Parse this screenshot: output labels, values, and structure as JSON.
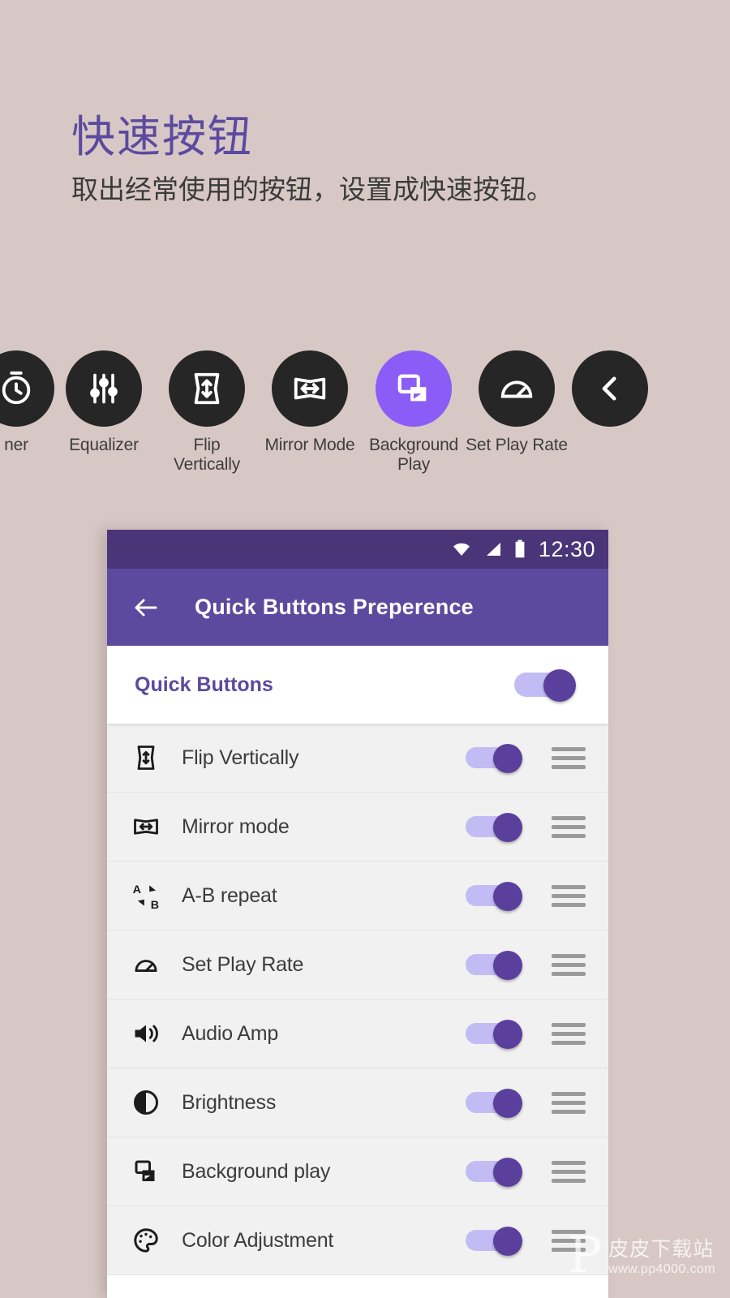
{
  "promo": {
    "title": "快速按钮",
    "subtitle": "取出经常使用的按钮，设置成快速按钮。"
  },
  "colors": {
    "background": "#d7c8c6",
    "accent_purple": "#5b4a9e",
    "statusbar_purple": "#4a3578",
    "highlight_purple": "#8b5cf6",
    "icon_dark": "#262626",
    "toggle_track": "#c3bbf3",
    "toggle_thumb": "#5b3f9d"
  },
  "quick_button_strip": [
    {
      "label": "ner",
      "icon": "timer-icon",
      "active": false
    },
    {
      "label": "Equalizer",
      "icon": "equalizer-icon",
      "active": false
    },
    {
      "label": "Flip\nVertically",
      "icon": "flip-vertically-icon",
      "active": false
    },
    {
      "label": "Mirror Mode",
      "icon": "mirror-mode-icon",
      "active": false
    },
    {
      "label": "Background\nPlay",
      "icon": "background-play-icon",
      "active": true
    },
    {
      "label": "Set Play Rate",
      "icon": "set-play-rate-icon",
      "active": false
    },
    {
      "label": "",
      "icon": "chevron-left-icon",
      "active": false
    }
  ],
  "phone": {
    "statusbar": {
      "clock": "12:30",
      "icons": [
        "wifi-icon",
        "signal-icon",
        "battery-icon"
      ]
    },
    "appbar": {
      "back_icon": "arrow-left-icon",
      "title": "Quick Buttons Preperence"
    },
    "master_row": {
      "label": "Quick Buttons",
      "enabled": true
    },
    "rows": [
      {
        "label": "Flip Vertically",
        "icon": "flip-vertically-icon",
        "enabled": true,
        "handle": "drag-handle-icon"
      },
      {
        "label": "Mirror mode",
        "icon": "mirror-mode-icon",
        "enabled": true,
        "handle": "drag-handle-icon"
      },
      {
        "label": "A-B repeat",
        "icon": "ab-repeat-icon",
        "enabled": true,
        "handle": "drag-handle-icon"
      },
      {
        "label": "Set Play Rate",
        "icon": "set-play-rate-icon",
        "enabled": true,
        "handle": "drag-handle-icon"
      },
      {
        "label": "Audio Amp",
        "icon": "audio-amp-icon",
        "enabled": true,
        "handle": "drag-handle-icon"
      },
      {
        "label": "Brightness",
        "icon": "brightness-icon",
        "enabled": true,
        "handle": "drag-handle-icon"
      },
      {
        "label": "Background play",
        "icon": "background-play-icon",
        "enabled": true,
        "handle": "drag-handle-icon"
      },
      {
        "label": "Color Adjustment",
        "icon": "color-adjustment-icon",
        "enabled": true,
        "handle": "drag-handle-icon"
      }
    ]
  },
  "watermark": {
    "glyph": "P",
    "name": "皮皮下载站",
    "url": "www.pp4000.com"
  }
}
